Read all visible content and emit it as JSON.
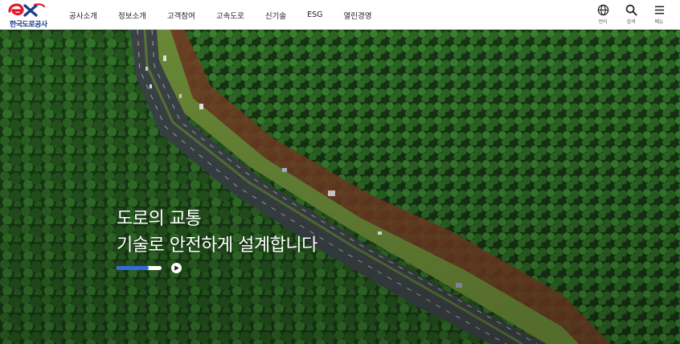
{
  "logo": {
    "mark_text": "ex",
    "name": "한국도로공사"
  },
  "nav": {
    "items": [
      {
        "label": "공사소개"
      },
      {
        "label": "정보소개"
      },
      {
        "label": "고객참여"
      },
      {
        "label": "고속도로"
      },
      {
        "label": "신기술"
      },
      {
        "label": "ESG"
      },
      {
        "label": "열린경영"
      }
    ]
  },
  "utility": {
    "language_label": "언어",
    "search_label": "검색",
    "menu_label": "메뉴"
  },
  "hero": {
    "headline_line1": "도로의 교통",
    "headline_line2": "기술로 안전하게 설계합니다",
    "slide_progress": 0.72
  },
  "colors": {
    "brand_blue": "#1b3f8f",
    "brand_red": "#e3192b",
    "progress_blue": "#2f6cdf"
  }
}
